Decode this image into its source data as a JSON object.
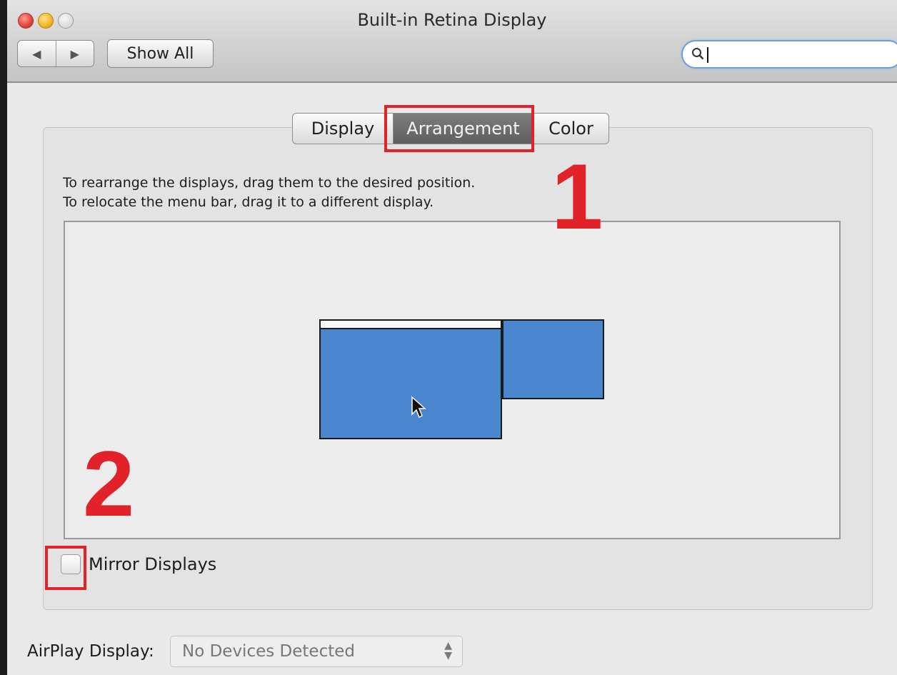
{
  "window": {
    "title": "Built-in Retina Display"
  },
  "toolbar": {
    "back_label": "◀",
    "forward_label": "▶",
    "show_all_label": "Show All",
    "search_value": ""
  },
  "tabs": [
    {
      "label": "Display",
      "selected": false
    },
    {
      "label": "Arrangement",
      "selected": true
    },
    {
      "label": "Color",
      "selected": false
    }
  ],
  "arrangement": {
    "instruction_line1": "To rearrange the displays, drag them to the desired position.",
    "instruction_line2": "To relocate the menu bar, drag it to a different display."
  },
  "mirror": {
    "label": "Mirror Displays",
    "checked": false
  },
  "airplay": {
    "label": "AirPlay Display:",
    "selected_value": "No Devices Detected"
  },
  "annotations": {
    "step1": "1",
    "step2": "2"
  },
  "colors": {
    "highlight": "#e12229",
    "display_fill": "#4a86cd",
    "selected_tab": "#6b6b6b"
  }
}
